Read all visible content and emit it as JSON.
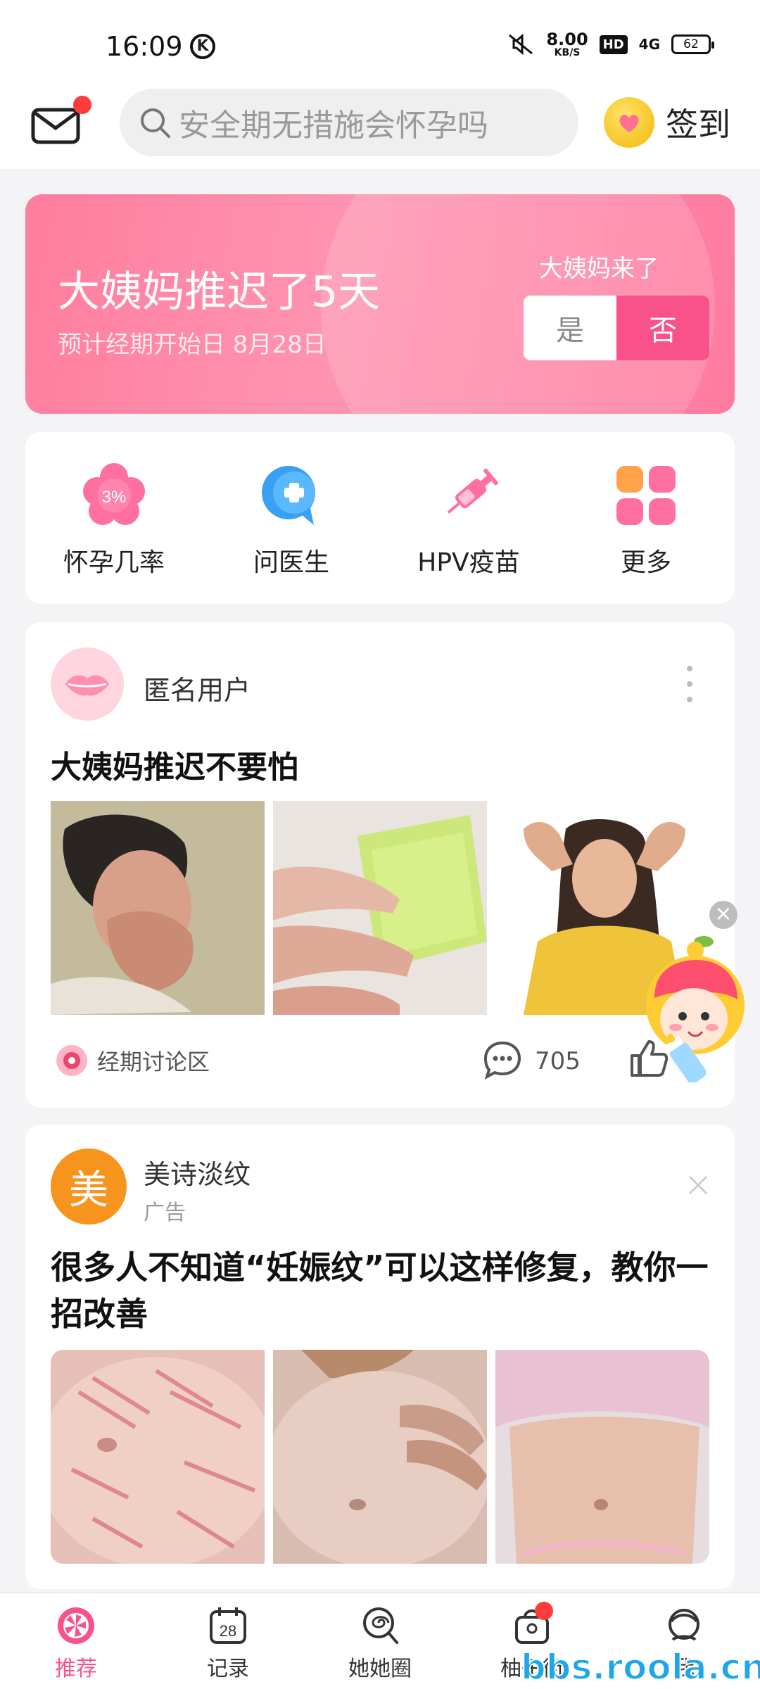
{
  "status_bar": {
    "time": "16:09",
    "k_badge": "K",
    "net_speed_value": "8.00",
    "net_speed_unit": "KB/S",
    "hd": "HD",
    "network": "4G",
    "battery": "62"
  },
  "header": {
    "search_placeholder": "安全期无措施会怀孕吗",
    "checkin_label": "签到"
  },
  "period": {
    "title": "大姨妈推迟了5天",
    "subtitle": "预计经期开始日 8月28日",
    "question": "大姨妈来了",
    "yes_label": "是",
    "no_label": "否"
  },
  "shortcuts": [
    {
      "label": "怀孕几率",
      "icon_text": "3%"
    },
    {
      "label": "问医生"
    },
    {
      "label": "HPV疫苗"
    },
    {
      "label": "更多"
    }
  ],
  "post": {
    "user": "匿名用户",
    "title": "大姨妈推迟不要怕",
    "tag": "经期讨论区",
    "comments": "705"
  },
  "ad": {
    "avatar_char": "美",
    "user": "美诗淡纹",
    "label": "广告",
    "title": "很多人不知道“妊娠纹”可以这样修复，教你一招改善"
  },
  "bottom_nav": [
    {
      "label": "推荐"
    },
    {
      "label": "记录",
      "icon_text": "28"
    },
    {
      "label": "她她圈"
    },
    {
      "label": "柚子街"
    },
    {
      "label": "我"
    }
  ],
  "watermark": "bbs.roola.cn",
  "colors": {
    "accent": "#f9528b",
    "banner_start": "#ff7d9e",
    "ad_avatar": "#f7941d"
  }
}
